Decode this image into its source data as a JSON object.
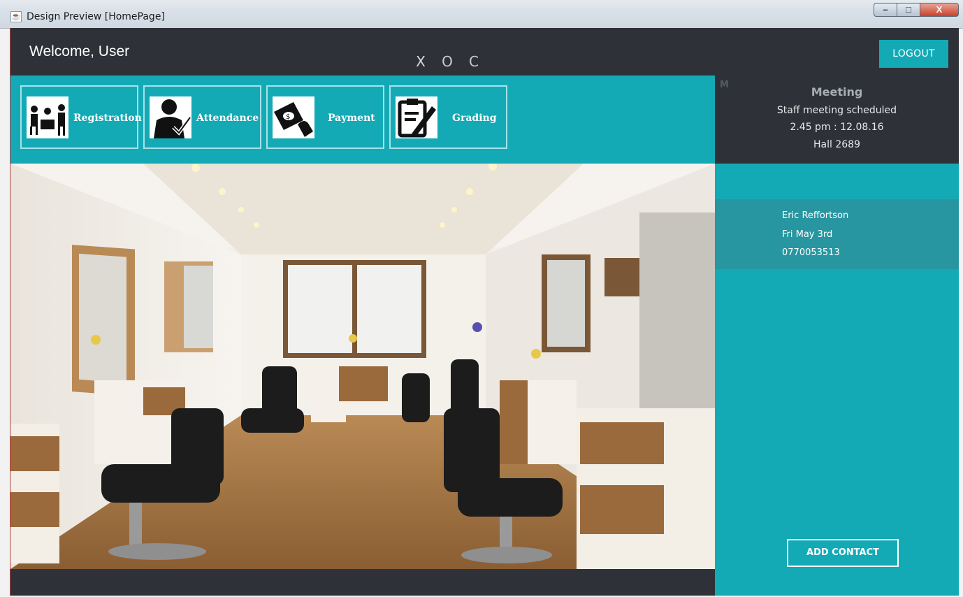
{
  "window": {
    "title": "Design Preview [HomePage]",
    "minimize": "–",
    "maximize": "□",
    "close": "X"
  },
  "header": {
    "welcome": "Welcome, User",
    "tabs": [
      "X",
      "O",
      "C"
    ],
    "logout": "LOGOUT"
  },
  "toolbar": {
    "items": [
      {
        "label": "Registration",
        "icon": "registration-icon"
      },
      {
        "label": "Attendance",
        "icon": "attendance-icon"
      },
      {
        "label": "Payment",
        "icon": "payment-icon"
      },
      {
        "label": "Grading",
        "icon": "grading-icon"
      }
    ]
  },
  "meeting": {
    "marker": "M",
    "title": "Meeting",
    "description": "Staff meeting scheduled",
    "time": "2.45 pm : 12.08.16",
    "location": "Hall 2689"
  },
  "contact": {
    "name": "Eric Reffortson",
    "date": "Fri May 3rd",
    "phone": "0770053513"
  },
  "actions": {
    "add_contact": "ADD CONTACT"
  },
  "colors": {
    "accent": "#13aab6",
    "dark": "#2e3238",
    "contact_bg": "#2796a0"
  }
}
